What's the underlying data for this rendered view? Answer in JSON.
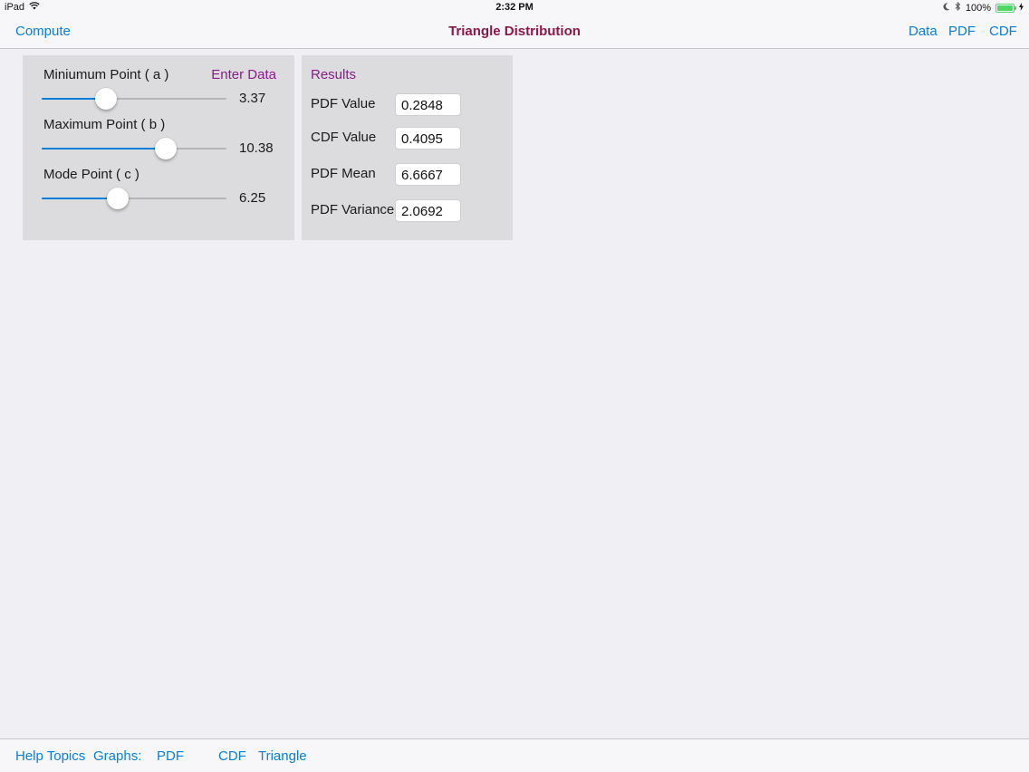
{
  "status_bar": {
    "device": "iPad",
    "time": "2:32 PM",
    "battery_text": "100%",
    "icons": [
      "wifi-icon",
      "moon-icon",
      "bluetooth-icon",
      "battery-icon",
      "charging-icon"
    ]
  },
  "nav": {
    "left_button": "Compute",
    "title": "Triangle Distribution",
    "right_buttons": [
      "Data",
      "PDF",
      "CDF"
    ]
  },
  "inputs": {
    "enter_data_label": "Enter Data",
    "params": [
      {
        "label": "Miniumum Point ( a )",
        "value": "3.37",
        "slider_fraction": 0.35
      },
      {
        "label": "Maximum Point ( b )",
        "value": "10.38",
        "slider_fraction": 0.67
      },
      {
        "label": "Mode Point ( c )",
        "value": "6.25",
        "slider_fraction": 0.41
      }
    ]
  },
  "results": {
    "title": "Results",
    "rows": [
      {
        "label": "PDF Value",
        "value": "0.2848"
      },
      {
        "label": "CDF Value",
        "value": "0.4095"
      },
      {
        "label": "PDF Mean",
        "value": "6.6667"
      },
      {
        "label": "PDF Variance",
        "value": "2.0692"
      }
    ]
  },
  "bottom_bar": {
    "items": [
      "Help Topics",
      "Graphs:",
      "PDF",
      "CDF",
      "Triangle"
    ]
  },
  "colors": {
    "accent": "#0a7fd9",
    "title": "#8b1a4a",
    "purple_label": "#8a1a8a",
    "battery": "#4cd964"
  }
}
